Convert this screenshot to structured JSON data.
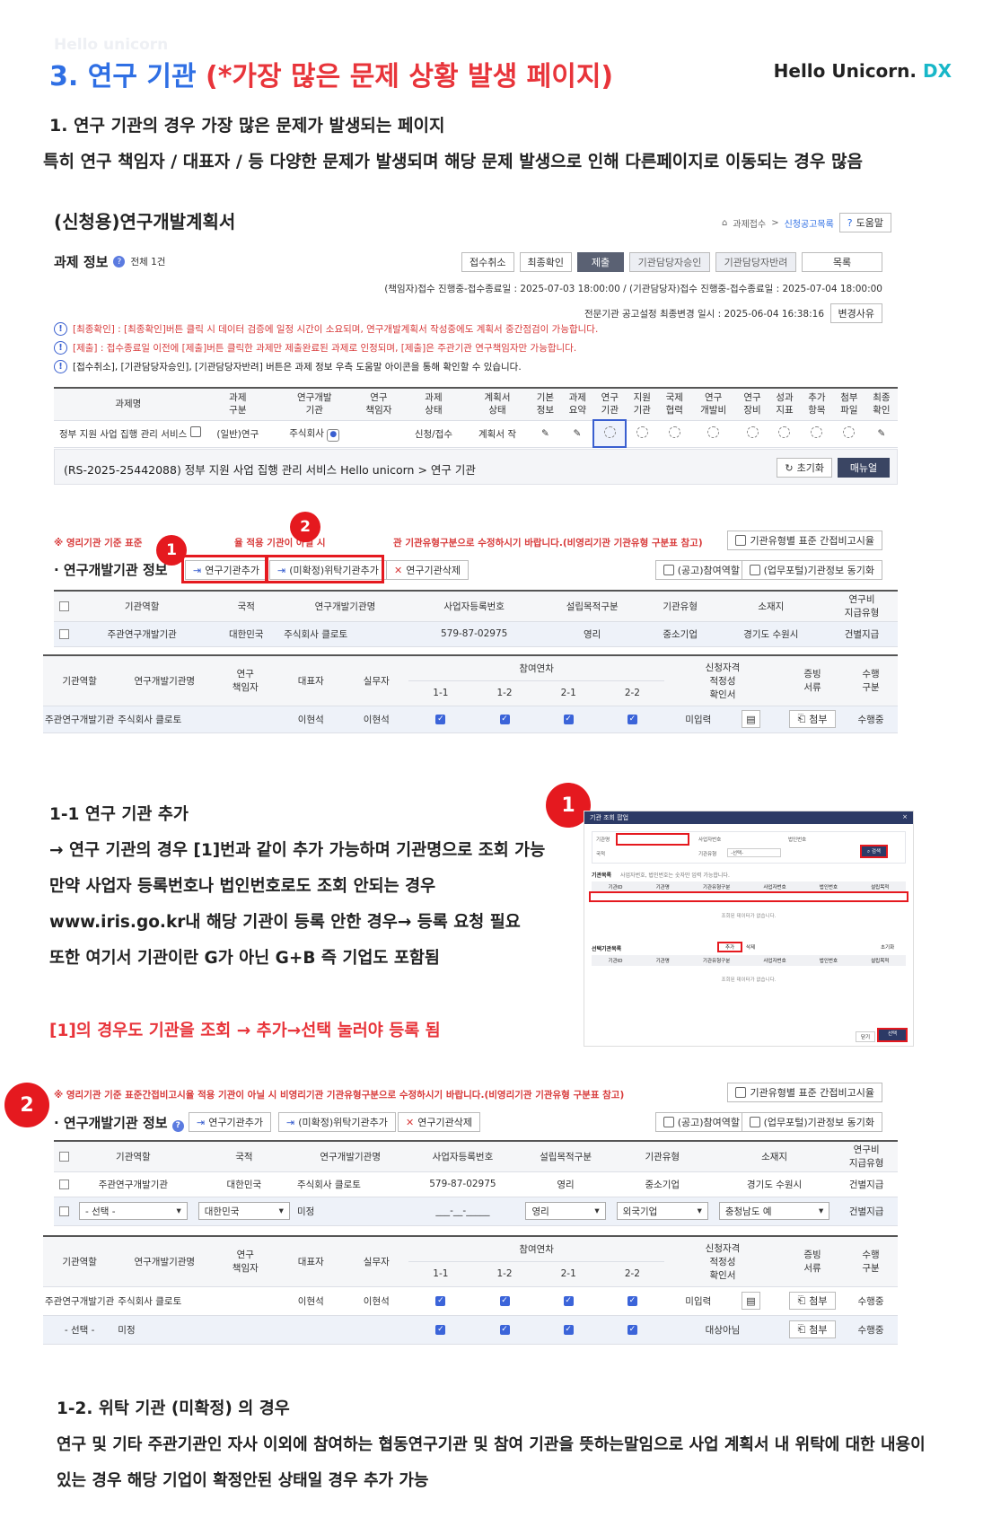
{
  "header": {
    "title_blue": "3. 연구 기관 ",
    "title_red": "(*가장 많은 문제 상황 발생 페이지)",
    "logo_main": "Hello Unicorn.",
    "logo_dx": "DX"
  },
  "intro": {
    "line1": "1. 연구 기관의 경우 가장 많은 문제가 발생되는 페이지",
    "line2": "특히 연구 책임자 / 대표자 / 등 다양한 문제가 발생되며 해당 문제 발생으로 인해 다른페이지로 이동되는 경우 많음"
  },
  "watermark": "Hello unicorn",
  "panel": {
    "title": "(신청용)연구개발계획서",
    "breadcrumb": {
      "home": "과제접수",
      "sep": ">",
      "current": "신청공고목록"
    },
    "help_btn": "도움말",
    "task_info": "과제 정보",
    "total": "전체 1건",
    "status_buttons": [
      "접수취소",
      "최종확인",
      "제출",
      "기관담당자승인",
      "기관담당자반려",
      "목록"
    ],
    "period": "(책임자)접수 진행중-접수종료일 : 2025-07-03 18:00:00 / (기관담당자)접수 진행중-접수종료일 : 2025-07-04 18:00:00",
    "change_date": "전문기관 공고설정 최종변경 일시 : 2025-06-04 16:38:16",
    "change_btn": "변경사유",
    "notices": [
      {
        "text": "[최종확인] : [최종확인]버튼 클릭 시 데이터 검증에 일정 시간이 소요되며, 연구개발계획서 작성중에도 계획서 중간점검이 가능합니다.",
        "red": true
      },
      {
        "text": "[제출] : 접수종료일 이전에 [제출]버튼 클릭한 과제만 제출완료된 과제로 인정되며, [제출]은 주관기관 연구책임자만 가능합니다.",
        "red": true
      },
      {
        "text": "[접수취소], [기관담당자승인], [기관담당자반려] 버튼은 과제 정보 우측 도움말 아이콘을 통해 확인할 수 있습니다.",
        "red": false
      }
    ],
    "task_headers": [
      "과제명",
      "과제\n구분",
      "연구개발\n기관",
      "연구\n책임자",
      "과제\n상태",
      "계획서\n상태",
      "기본\n정보",
      "과제\n요약",
      "연구\n기관",
      "지원\n기관",
      "국제\n협력",
      "연구\n개발비",
      "연구\n장비",
      "성과\n지표",
      "추가\n항목",
      "첨부\n파일",
      "최종\n확인"
    ],
    "task_row": {
      "name": "정부 지원 사업 집행 관리 서비스",
      "type": "(일반)연구",
      "org": "주식회사",
      "status": "신청/접수",
      "plan": "계획서 작"
    },
    "path": "(RS-2025-25442088) 정부 지원 사업 집행 관리 서비스 Hello unicorn > 연구 기관",
    "reset_btn": "초기화",
    "manual_btn": "매뉴얼",
    "warn": "※ 영리기관 기준 표준간접비고시율 적용 기관이 아닐 시 비영리기관 기관유형구분으로 수정하시기 바랍니다.(비영리기관 기관유형 구분표 참고)",
    "warn_partial_left": "※ 영리기관 기준 표준",
    "warn_partial_mid": "율 적용 기관이 아닐 시",
    "warn_partial_right": "관 기관유형구분으로 수정하시기 바랍니다.(비영리기관 기관유형 구분표 참고)",
    "std_btn": "기관유형별 표준 간접비고시율",
    "org_info": "연구개발기관 정보",
    "add_org": "연구기관추가",
    "add_consign": "(미확정)위탁기관추가",
    "del_org": "연구기관삭제",
    "participate_btn": "(공고)참여역할",
    "sync_btn": "(업무포털)기관정보 동기화",
    "org_headers": [
      "기관역할",
      "국적",
      "연구개발기관명",
      "사업자등록번호",
      "설립목적구분",
      "기관유형",
      "소재지",
      "연구비\n지급유형"
    ],
    "org_row": [
      "주관연구개발기관",
      "대한민국",
      "주식회사 클로토",
      "579-87-02975",
      "영리",
      "중소기업",
      "경기도 수원시",
      "건별지급"
    ],
    "part_headers": {
      "role": "기관역할",
      "name": "연구개발기관명",
      "lead": "연구\n책임자",
      "rep": "대표자",
      "staff": "실무자",
      "years": "참여연차",
      "y": [
        "1-1",
        "1-2",
        "2-1",
        "2-2"
      ],
      "qual": "신청자격\n적정성\n확인서",
      "proof": "증빙\n서류",
      "exec": "수행\n구분"
    },
    "part_row": {
      "role": "주관연구개발기관",
      "name": "주식회사 클로토",
      "rep": "이현석",
      "staff": "이현석",
      "qual": "미입력",
      "attach": "첨부",
      "exec": "수행중"
    }
  },
  "marks": {
    "one": "1",
    "two": "2"
  },
  "section11": {
    "title": "1-1 연구 기관 추가",
    "lines": [
      "→ 연구 기관의 경우 [1]번과 같이 추가 가능하며 기관명으로 조회 가능",
      "만약 사업자 등록번호나 법인번호로도 조회 안되는 경우",
      "www.iris.go.kr내 해당 기관이 등록 안한 경우→ 등록 요청 필요",
      "또한 여기서 기관이란 G가 아닌 G+B 즉 기업도 포함됨"
    ],
    "note": "[1]의 경우도 기관을 조회 → 추가→선택 눌러야 등록 됨"
  },
  "popup": {
    "title": "기관 조회 팝업",
    "close": "×",
    "lbl_org": "기관명",
    "lbl_bizno": "사업자번호",
    "lbl_corpno": "법인번호",
    "lbl_country": "국적",
    "lbl_type": "기관유형",
    "type_val": "-선택-",
    "search": "검색",
    "list_title": "기관목록",
    "list_hint": "사업자번호, 법인번호는 숫자만 입력 가능합니다.",
    "cols": [
      "기관ID",
      "기관명",
      "기관유형구분",
      "사업자번호",
      "법인번호",
      "설립목적"
    ],
    "empty": "조회된 데이터가 없습니다.",
    "sel_title": "선택기관목록",
    "add": "추가",
    "del": "삭제",
    "reset": "초기화",
    "cancel": "닫기",
    "select": "선택"
  },
  "panel2": {
    "select": "- 선택 -",
    "country": "대한민국",
    "undecided": "미정",
    "bizno": "___-__-_____",
    "purpose": "영리",
    "otype": "외국기업",
    "region": "충청남도 예",
    "pay": "건별지급",
    "row2": {
      "role": "- 선택 -",
      "name": "미정",
      "qual": "대상아님",
      "attach": "첨부",
      "exec": "수행중"
    }
  },
  "section12": {
    "title": "1-2. 위탁 기관 (미확정) 의 경우",
    "line1": "연구 및 기타 주관기관인 자사 이외에 참여하는 협동연구기관 및 참여 기관을 뜻하는말임으로 사업 계획서 내 위탁에 대한 내용이",
    "line2": "있는 경우 해당 기업이 확정안된 상태일 경우 추가 가능"
  }
}
